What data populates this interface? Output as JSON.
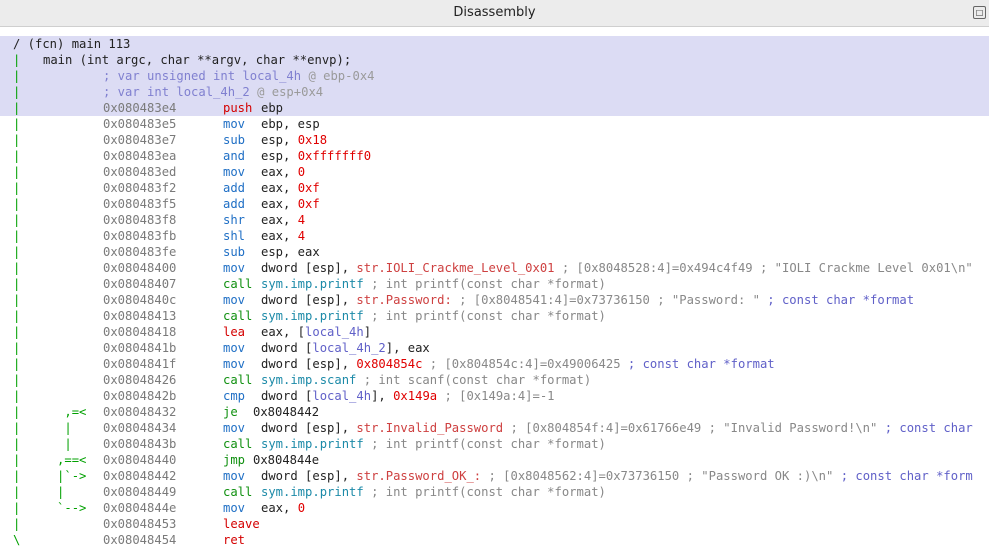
{
  "window": {
    "title": "Disassembly"
  },
  "header": {
    "fcn": "/ (fcn) main 113",
    "signature": "main (int argc, char **argv, char **envp);"
  },
  "vars": [
    {
      "text": "; var unsigned int local_4h",
      "loc": " @ ebp-0x4"
    },
    {
      "text": "; var int local_4h_2",
      "loc": " @ esp+0x4"
    }
  ],
  "lines": [
    {
      "gut": "|",
      "addr": "0x080483e4",
      "mn": "push",
      "mc": "m-red",
      "ops": [
        [
          "ebp",
          "m-plain"
        ]
      ],
      "hl": true
    },
    {
      "gut": "|",
      "addr": "0x080483e5",
      "mn": "mov",
      "mc": "m-blu",
      "ops": [
        [
          "ebp, esp",
          "m-plain"
        ]
      ]
    },
    {
      "gut": "|",
      "addr": "0x080483e7",
      "mn": "sub",
      "mc": "m-blu",
      "ops": [
        [
          "esp, ",
          "m-plain"
        ],
        [
          "0x18",
          "c-num"
        ]
      ]
    },
    {
      "gut": "|",
      "addr": "0x080483ea",
      "mn": "and",
      "mc": "m-blu",
      "ops": [
        [
          "esp, ",
          "m-plain"
        ],
        [
          "0xfffffff0",
          "c-num"
        ]
      ]
    },
    {
      "gut": "|",
      "addr": "0x080483ed",
      "mn": "mov",
      "mc": "m-blu",
      "ops": [
        [
          "eax, ",
          "m-plain"
        ],
        [
          "0",
          "c-num"
        ]
      ]
    },
    {
      "gut": "|",
      "addr": "0x080483f2",
      "mn": "add",
      "mc": "m-blu",
      "ops": [
        [
          "eax, ",
          "m-plain"
        ],
        [
          "0xf",
          "c-num"
        ]
      ]
    },
    {
      "gut": "|",
      "addr": "0x080483f5",
      "mn": "add",
      "mc": "m-blu",
      "ops": [
        [
          "eax, ",
          "m-plain"
        ],
        [
          "0xf",
          "c-num"
        ]
      ]
    },
    {
      "gut": "|",
      "addr": "0x080483f8",
      "mn": "shr",
      "mc": "m-blu",
      "ops": [
        [
          "eax, ",
          "m-plain"
        ],
        [
          "4",
          "c-num"
        ]
      ]
    },
    {
      "gut": "|",
      "addr": "0x080483fb",
      "mn": "shl",
      "mc": "m-blu",
      "ops": [
        [
          "eax, ",
          "m-plain"
        ],
        [
          "4",
          "c-num"
        ]
      ]
    },
    {
      "gut": "|",
      "addr": "0x080483fe",
      "mn": "sub",
      "mc": "m-blu",
      "ops": [
        [
          "esp, eax",
          "m-plain"
        ]
      ]
    },
    {
      "gut": "|",
      "addr": "0x08048400",
      "mn": "mov",
      "mc": "m-blu",
      "ops": [
        [
          "dword [esp], ",
          "m-plain"
        ],
        [
          "str.IOLI_Crackme_Level_0x01",
          "c-str"
        ],
        [
          " ; [0x8048528:4]=0x494c4f49 ; \"IOLI Crackme Level 0x01\\n\"",
          "c-com"
        ]
      ]
    },
    {
      "gut": "|",
      "addr": "0x08048407",
      "mn": "call",
      "mc": "m-grn",
      "ops": [
        [
          "sym.imp.printf",
          "c-sym"
        ],
        [
          " ; int printf(const char *format)",
          "c-com"
        ]
      ]
    },
    {
      "gut": "|",
      "addr": "0x0804840c",
      "mn": "mov",
      "mc": "m-blu",
      "ops": [
        [
          "dword [esp], ",
          "m-plain"
        ],
        [
          "str.Password:",
          "c-str"
        ],
        [
          " ; [0x8048541:4]=0x73736150 ; \"Password: \" ",
          "c-com"
        ],
        [
          "; const char *format",
          "c-type"
        ]
      ]
    },
    {
      "gut": "|",
      "addr": "0x08048413",
      "mn": "call",
      "mc": "m-grn",
      "ops": [
        [
          "sym.imp.printf",
          "c-sym"
        ],
        [
          " ; int printf(const char *format)",
          "c-com"
        ]
      ]
    },
    {
      "gut": "|",
      "addr": "0x08048418",
      "mn": "lea",
      "mc": "m-red",
      "ops": [
        [
          "eax, [",
          "m-plain"
        ],
        [
          "local_4h",
          "c-type"
        ],
        [
          "]",
          "m-plain"
        ]
      ]
    },
    {
      "gut": "|",
      "addr": "0x0804841b",
      "mn": "mov",
      "mc": "m-blu",
      "ops": [
        [
          "dword [",
          "m-plain"
        ],
        [
          "local_4h_2",
          "c-type"
        ],
        [
          "], eax",
          "m-plain"
        ]
      ]
    },
    {
      "gut": "|",
      "addr": "0x0804841f",
      "mn": "mov",
      "mc": "m-blu",
      "ops": [
        [
          "dword [esp], ",
          "m-plain"
        ],
        [
          "0x804854c",
          "c-num"
        ],
        [
          " ; [0x804854c:4]=0x49006425 ",
          "c-com"
        ],
        [
          "; const char *format",
          "c-type"
        ]
      ]
    },
    {
      "gut": "|",
      "addr": "0x08048426",
      "mn": "call",
      "mc": "m-grn",
      "ops": [
        [
          "sym.imp.scanf",
          "c-sym"
        ],
        [
          " ; int scanf(const char *format)",
          "c-com"
        ]
      ]
    },
    {
      "gut": "|",
      "addr": "0x0804842b",
      "mn": "cmp",
      "mc": "m-blu",
      "ops": [
        [
          "dword [",
          "m-plain"
        ],
        [
          "local_4h",
          "c-type"
        ],
        [
          "], ",
          "m-plain"
        ],
        [
          "0x149a",
          "c-num"
        ],
        [
          " ; [0x149a:4]=-1",
          "c-com"
        ]
      ]
    },
    {
      "gut": "|      ,=<",
      "addr": "0x08048432",
      "mn": "je",
      "mc": "m-grn",
      "ops": [
        [
          "0x8048442",
          "m-plain"
        ]
      ],
      "opoff": true
    },
    {
      "gut": "|      |",
      "addr": "0x08048434",
      "mn": "mov",
      "mc": "m-blu",
      "ops": [
        [
          "dword [esp], ",
          "m-plain"
        ],
        [
          "str.Invalid_Password",
          "c-str"
        ],
        [
          " ; [0x804854f:4]=0x61766e49 ; \"Invalid Password!\\n\" ",
          "c-com"
        ],
        [
          "; const char",
          "c-type"
        ]
      ]
    },
    {
      "gut": "|      |",
      "addr": "0x0804843b",
      "mn": "call",
      "mc": "m-grn",
      "ops": [
        [
          "sym.imp.printf",
          "c-sym"
        ],
        [
          " ; int printf(const char *format)",
          "c-com"
        ]
      ]
    },
    {
      "gut": "|     ,==<",
      "addr": "0x08048440",
      "mn": "jmp",
      "mc": "m-grn",
      "ops": [
        [
          "0x804844e",
          "m-plain"
        ]
      ],
      "opoff": true
    },
    {
      "gut": "|     |`->",
      "addr": "0x08048442",
      "mn": "mov",
      "mc": "m-blu",
      "ops": [
        [
          "dword [esp], ",
          "m-plain"
        ],
        [
          "str.Password_OK_:",
          "c-str"
        ],
        [
          " ; [0x8048562:4]=0x73736150 ; \"Password OK :)\\n\" ",
          "c-com"
        ],
        [
          "; const char *form",
          "c-type"
        ]
      ]
    },
    {
      "gut": "|     |",
      "addr": "0x08048449",
      "mn": "call",
      "mc": "m-grn",
      "ops": [
        [
          "sym.imp.printf",
          "c-sym"
        ],
        [
          " ; int printf(const char *format)",
          "c-com"
        ]
      ]
    },
    {
      "gut": "|     `-->",
      "addr": "0x0804844e",
      "mn": "mov",
      "mc": "m-blu",
      "ops": [
        [
          "eax, ",
          "m-plain"
        ],
        [
          "0",
          "c-num"
        ]
      ]
    },
    {
      "gut": "|",
      "addr": "0x08048453",
      "mn": "leave",
      "mc": "m-red",
      "ops": []
    },
    {
      "gut": "\\",
      "addr": "0x08048454",
      "mn": "ret",
      "mc": "m-red",
      "ops": []
    }
  ]
}
